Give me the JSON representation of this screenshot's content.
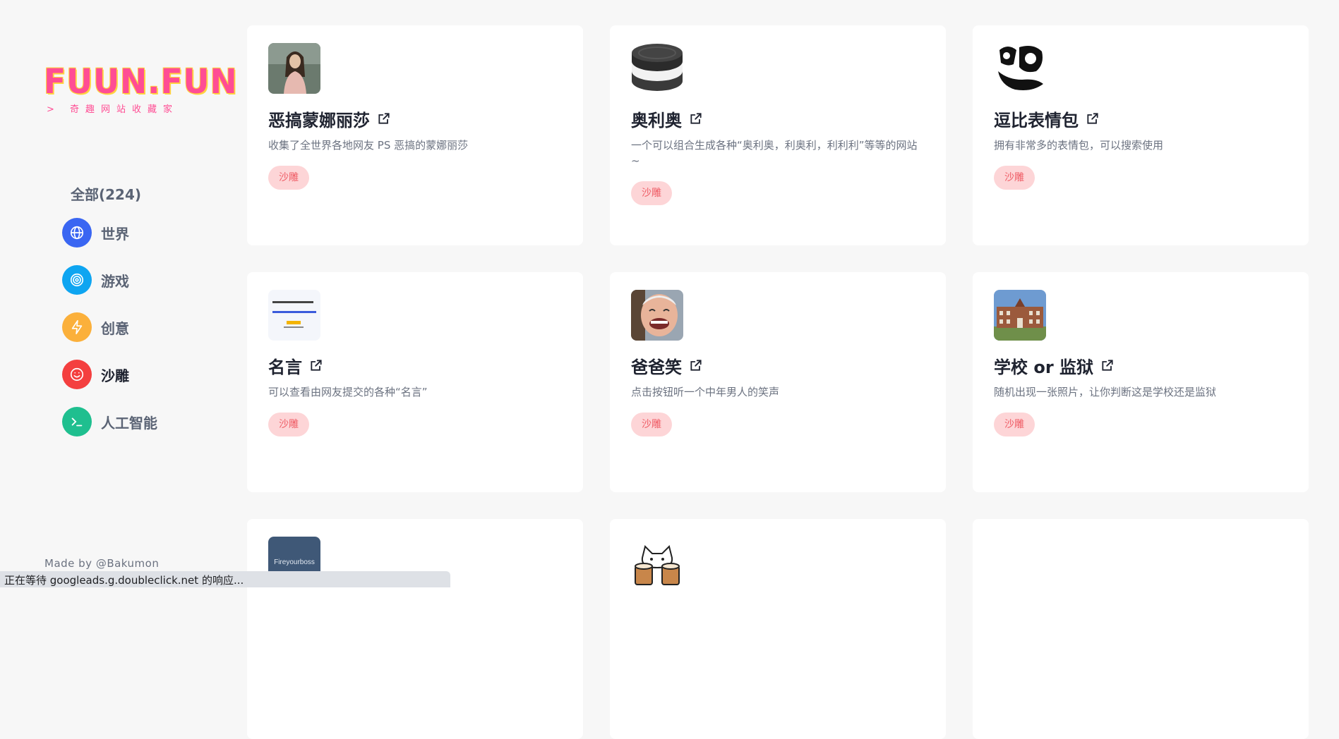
{
  "logo": {
    "text": "FUUN.FUN",
    "subtitle": "> 奇趣网站收藏家"
  },
  "nav": {
    "all_label": "全部(224)",
    "items": [
      {
        "label": "世界",
        "icon": "globe-icon",
        "color": "#3a66f2"
      },
      {
        "label": "游戏",
        "icon": "target-icon",
        "color": "#0ea5f1"
      },
      {
        "label": "创意",
        "icon": "lightning-icon",
        "color": "#fbb03b"
      },
      {
        "label": "沙雕",
        "icon": "smile-icon",
        "color": "#f43f3f"
      },
      {
        "label": "人工智能",
        "icon": "terminal-icon",
        "color": "#1fbf8f"
      }
    ]
  },
  "footer": {
    "made_by": "Made by @Bakumon"
  },
  "cards": [
    {
      "title": "恶搞蒙娜丽莎",
      "desc": "收集了全世界各地网友 PS 恶搞的蒙娜丽莎",
      "tag": "沙雕",
      "thumb": "mona-lisa-thumbnail"
    },
    {
      "title": "奥利奥",
      "desc": "一个可以组合生成各种“奥利奥，利奥利，利利利”等等的网站~",
      "tag": "沙雕",
      "thumb": "oreo-thumbnail"
    },
    {
      "title": "逗比表情包",
      "desc": "拥有非常多的表情包，可以搜索使用",
      "tag": "沙雕",
      "thumb": "doubi-logo-thumbnail"
    },
    {
      "title": "名言",
      "desc": "可以查看由网友提交的各种“名言”",
      "tag": "沙雕",
      "thumb": "quote-thumbnail"
    },
    {
      "title": "爸爸笑",
      "desc": "点击按钮听一个中年男人的笑声",
      "tag": "沙雕",
      "thumb": "laughing-man-thumbnail"
    },
    {
      "title": "学校 or 监狱",
      "desc": "随机出现一张照片，让你判断这是学校还是监狱",
      "tag": "沙雕",
      "thumb": "building-thumbnail"
    },
    {
      "title": "",
      "desc": "",
      "tag": "",
      "thumb": "fireyourboss-thumbnail",
      "thumb_text": "Fireyourboss"
    },
    {
      "title": "",
      "desc": "",
      "tag": "",
      "thumb": "bongo-cat-thumbnail"
    },
    {
      "title": "",
      "desc": "",
      "tag": "",
      "thumb": ""
    }
  ],
  "status_bar": {
    "text": "正在等待 googleads.g.doubleclick.net 的响应..."
  }
}
